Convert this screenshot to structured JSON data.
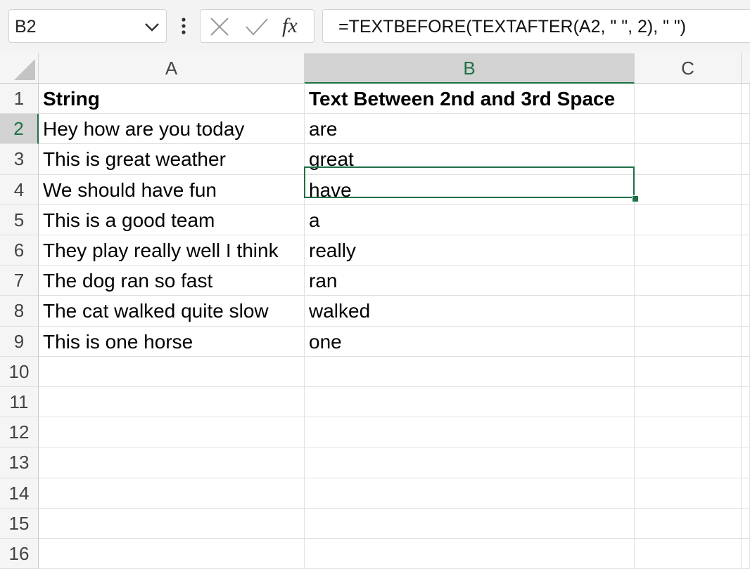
{
  "formula_bar": {
    "name_box": "B2",
    "fx_label": "fx",
    "formula": "=TEXTBEFORE(TEXTAFTER(A2, \" \", 2), \" \")"
  },
  "columns": [
    "A",
    "B",
    "C"
  ],
  "row_numbers": [
    "1",
    "2",
    "3",
    "4",
    "5",
    "6",
    "7",
    "8",
    "9",
    "10",
    "11",
    "12",
    "13",
    "14",
    "15",
    "16"
  ],
  "active_cell": "B2",
  "cells": {
    "A1": "String",
    "B1": "Text Between 2nd and 3rd Space",
    "A2": "Hey how are you today",
    "B2": "are",
    "A3": "This is great weather",
    "B3": "great",
    "A4": "We should have fun",
    "B4": "have",
    "A5": "This is a good team",
    "B5": "a",
    "A6": "They play really well I think",
    "B6": "really",
    "A7": "The dog ran so fast",
    "B7": "ran",
    "A8": "The cat walked quite slow",
    "B8": "walked",
    "A9": "This is one horse",
    "B9": "one"
  },
  "colors": {
    "accent": "#1e7145",
    "header_bg": "#f5f5f5",
    "active_header_bg": "#d2d2d2",
    "gridline": "#e1e1e1"
  }
}
